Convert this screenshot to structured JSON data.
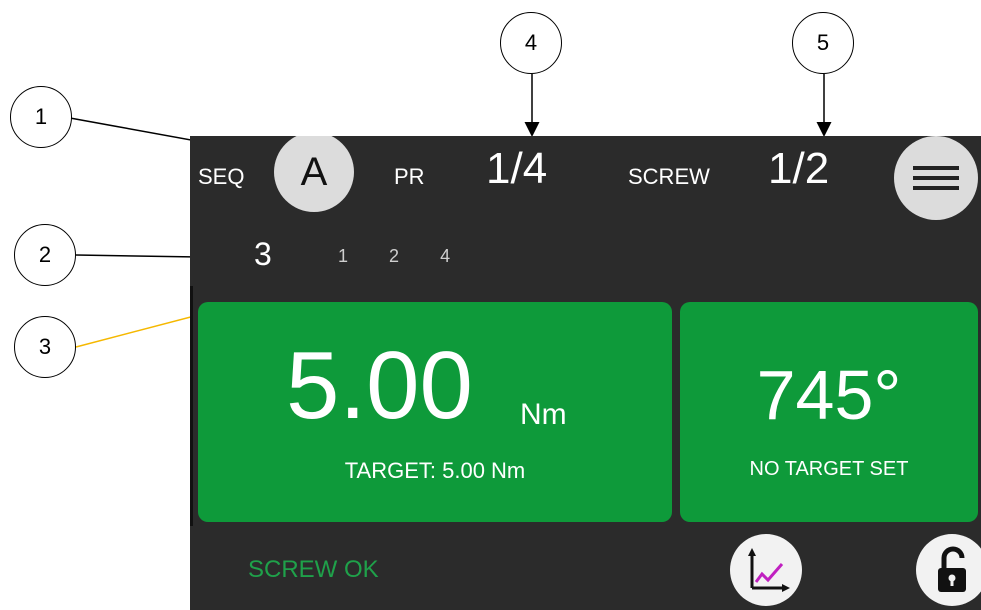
{
  "callouts": [
    "1",
    "2",
    "3",
    "4",
    "5"
  ],
  "header": {
    "seq_label": "SEQ",
    "seq_value": "A",
    "pr_label": "PR",
    "pr_value": "1/4",
    "screw_label": "SCREW",
    "screw_value": "1/2"
  },
  "programs": {
    "current": "3",
    "others": [
      "1",
      "2",
      "4"
    ]
  },
  "torque": {
    "value": "5.00",
    "unit": "Nm",
    "target": "TARGET: 5.00 Nm"
  },
  "angle": {
    "value": "745°",
    "target": "NO TARGET SET"
  },
  "status": {
    "text": "SCREW OK"
  },
  "colors": {
    "panel_green": "#0e9a3a",
    "status_green": "#1fa14a",
    "screen_bg": "#2b2b2b",
    "button_bg": "#dcdcdc",
    "callout_line_3": "#f5b800"
  },
  "icons": {
    "menu": "hamburger-icon",
    "graph": "graph-icon",
    "lock": "unlock-icon"
  }
}
